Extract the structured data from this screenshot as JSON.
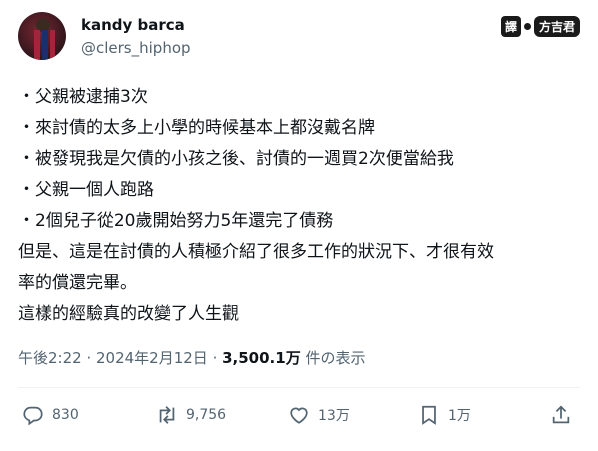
{
  "author": {
    "name": "kandy barca",
    "handle": "@clers_hiphop"
  },
  "badge": {
    "left": "譯",
    "right": "方吉君"
  },
  "tweet": {
    "lines": [
      "・父親被逮捕3次",
      "・來討債的太多上小學的時候基本上都沒戴名牌",
      "・被發現我是欠債的小孩之後、討債的一週買2次便當給我",
      "・父親一個人跑路",
      "・2個兒子從20歲開始努力5年還完了債務",
      "但是、這是在討債的人積極介紹了很多工作的狀況下、才很有效",
      "率的償還完畢。",
      "這樣的經驗真的改變了人生觀"
    ]
  },
  "meta": {
    "timestamp": "午後2:22 · 2024年2月12日",
    "separator": " · ",
    "views_count": "3,500.1万",
    "views_label": " 件の表示"
  },
  "actions": {
    "reply_count": "830",
    "retweet_count": "9,756",
    "like_count": "13万",
    "bookmark_count": "1万"
  },
  "icons": {
    "reply": "reply-icon",
    "retweet": "retweet-icon",
    "like": "heart-icon",
    "bookmark": "bookmark-icon",
    "share": "share-icon"
  }
}
